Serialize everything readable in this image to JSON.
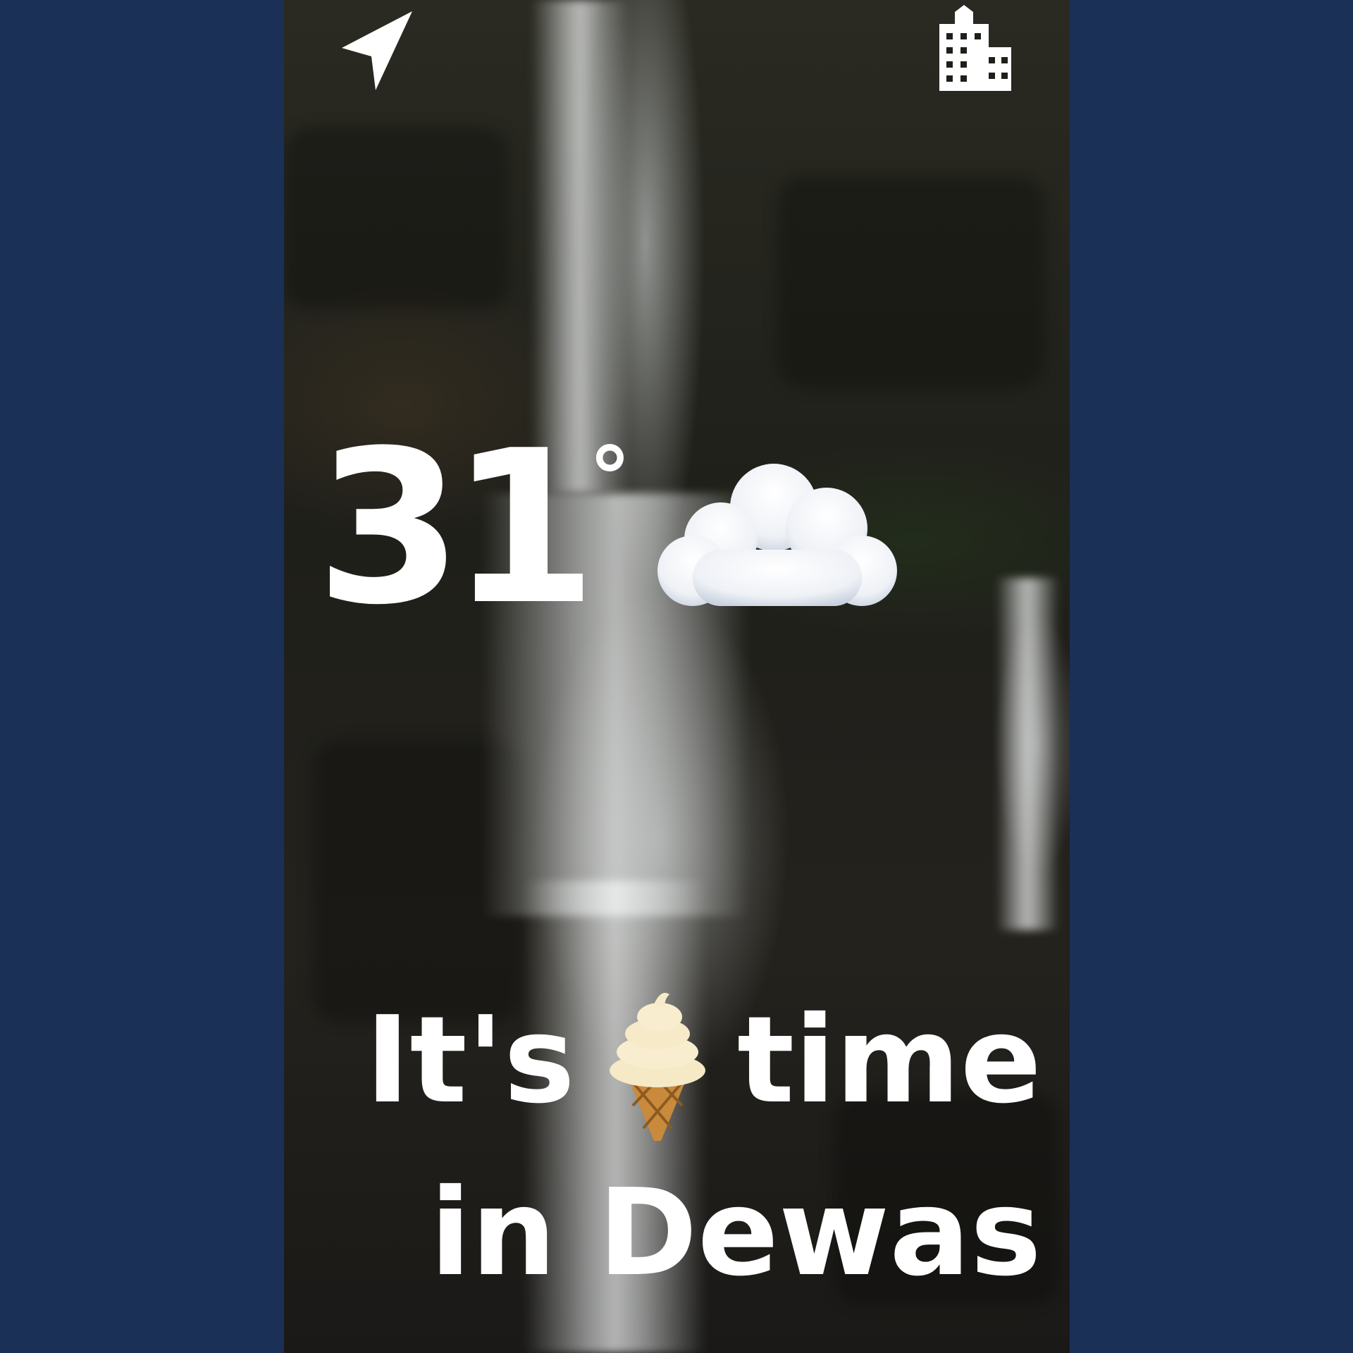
{
  "header": {
    "left_icon": "navigation-arrow-icon",
    "right_icon": "building-icon"
  },
  "weather": {
    "temperature": "31",
    "degree_symbol": "°",
    "condition_icon": "cloud-icon"
  },
  "message": {
    "part1": "It's",
    "emoji_icon": "ice-cream-icon",
    "part2": "time",
    "line2": "in Dewas"
  },
  "colors": {
    "page_background": "#1b3056",
    "text": "#ffffff"
  }
}
